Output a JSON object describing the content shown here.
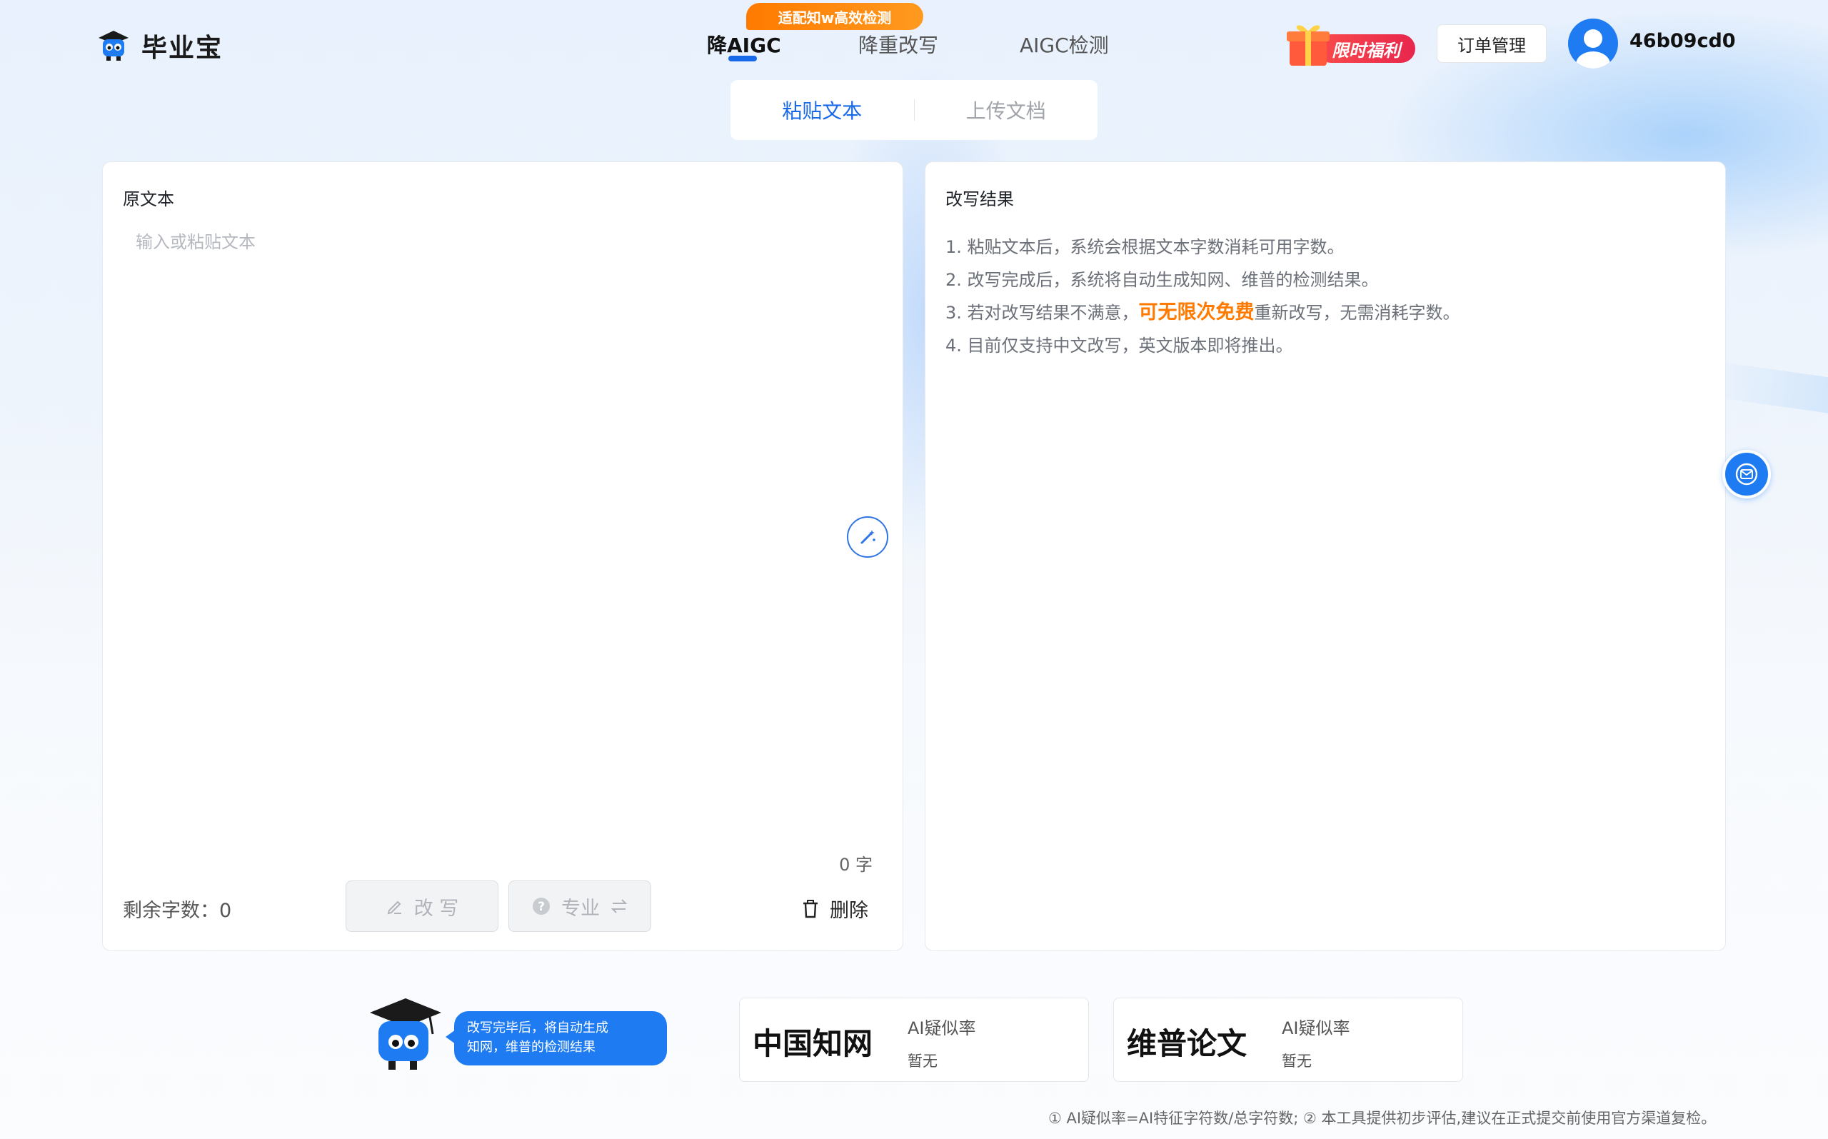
{
  "brand": {
    "name": "毕业宝"
  },
  "nav": {
    "items": [
      {
        "label": "降AIGC",
        "active": true
      },
      {
        "label": "降重改写",
        "active": false
      },
      {
        "label": "AIGC检测",
        "active": false
      }
    ],
    "badge": "适配知w高效检测"
  },
  "header": {
    "promo_label": "限时福利",
    "order_button": "订单管理",
    "username": "46b09cd0"
  },
  "mode_tabs": [
    {
      "label": "粘贴文本",
      "active": true
    },
    {
      "label": "上传文档",
      "active": false
    }
  ],
  "left_panel": {
    "title": "原文本",
    "placeholder": "输入或粘贴文本",
    "char_count": "0 字",
    "remaining_label": "剩余字数：0",
    "rewrite_button": "改 写",
    "pro_button": "专业",
    "delete_button": "删除"
  },
  "right_panel": {
    "title": "改写结果",
    "tips": {
      "t1": "1. 粘贴文本后，系统会根据文本字数消耗可用字数。",
      "t2": "2. 改写完成后，系统将自动生成知网、维普的检测结果。",
      "t3_before": "3. 若对改写结果不满意，",
      "t3_highlight": "可无限次免费",
      "t3_after": "重新改写，无需消耗字数。",
      "t4": "4. 目前仅支持中文改写，英文版本即将推出。"
    }
  },
  "bottom": {
    "bubble_line1": "改写完毕后，将自动生成",
    "bubble_line2": "知网，维普的检测结果",
    "cards": [
      {
        "name": "中国知网",
        "label": "AI疑似率",
        "value": "暂无"
      },
      {
        "name": "维普论文",
        "label": "AI疑似率",
        "value": "暂无"
      }
    ],
    "footnote": "① AI疑似率=AI特征字符数/总字符数; ② 本工具提供初步评估,建议在正式提交前使用官方渠道复检。"
  },
  "colors": {
    "accent": "#1769e8",
    "orange": "#ff7a00",
    "promo": "#e8264d"
  }
}
